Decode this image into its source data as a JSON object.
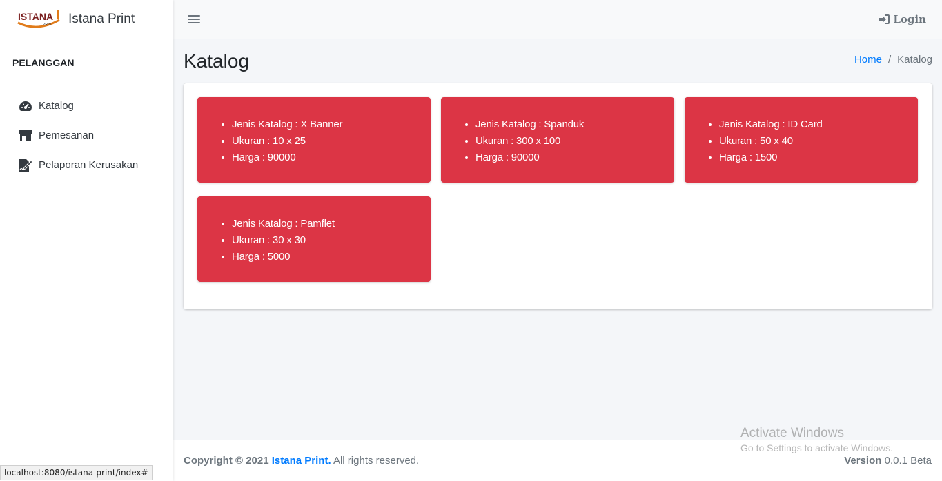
{
  "brand": {
    "name": "Istana Print",
    "logo_text": "ISTANA",
    "logo_sub": "PRINT"
  },
  "sidebar": {
    "header": "PELANGGAN",
    "items": [
      {
        "label": "Katalog",
        "icon": "tachometer-icon"
      },
      {
        "label": "Pemesanan",
        "icon": "store-icon"
      },
      {
        "label": "Pelaporan Kerusakan",
        "icon": "file-signature-icon"
      }
    ]
  },
  "topbar": {
    "login_label": "Login"
  },
  "page": {
    "title": "Katalog",
    "breadcrumb": {
      "home": "Home",
      "separator": "/",
      "current": "Katalog"
    }
  },
  "katalog": [
    {
      "jenis": "Jenis Katalog : X Banner",
      "ukuran": "Ukuran : 10 x 25",
      "harga": "Harga : 90000"
    },
    {
      "jenis": "Jenis Katalog : Spanduk",
      "ukuran": "Ukuran : 300 x 100",
      "harga": "Harga : 90000"
    },
    {
      "jenis": "Jenis Katalog : ID Card",
      "ukuran": "Ukuran : 50 x 40",
      "harga": "Harga : 1500"
    },
    {
      "jenis": "Jenis Katalog : Pamflet",
      "ukuran": "Ukuran : 30 x 30",
      "harga": "Harga : 5000"
    }
  ],
  "footer": {
    "copyright_prefix": "Copyright © 2021",
    "brand_link": "Istana Print.",
    "rights": "All rights reserved.",
    "version_label": "Version",
    "version_value": "0.0.1 Beta"
  },
  "watermark": {
    "title": "Activate Windows",
    "subtitle": "Go to Settings to activate Windows."
  },
  "statusbar": {
    "url": "localhost:8080/istana-print/index#"
  },
  "colors": {
    "card_red": "#dc3545",
    "link_blue": "#007bff",
    "muted": "#6c757d"
  }
}
